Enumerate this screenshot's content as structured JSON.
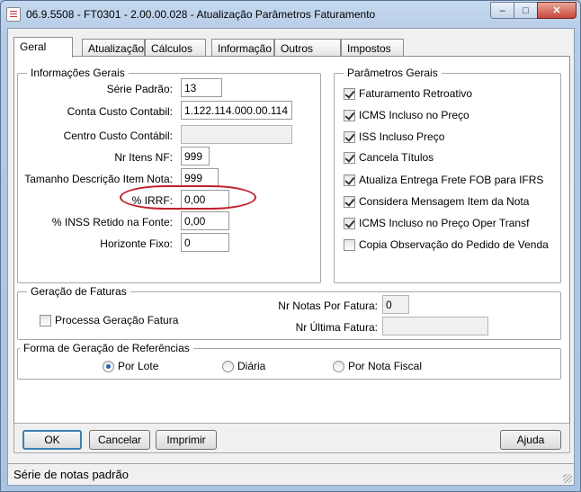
{
  "window": {
    "title": "06.9.5508 - FT0301 - 2.00.00.028 - Atualização Parâmetros Faturamento",
    "minimize_glyph": "–",
    "maximize_glyph": "□",
    "close_glyph": "✕"
  },
  "tabs": [
    {
      "label": "Geral",
      "active": true
    },
    {
      "label": "Atualização"
    },
    {
      "label": "Cálculos"
    },
    {
      "label": "Informação"
    },
    {
      "label": "Outros"
    },
    {
      "label": "Impostos"
    }
  ],
  "informacoes_gerais": {
    "title": "Informações Gerais",
    "fields": [
      {
        "label": "Série Padrão:",
        "value": "13"
      },
      {
        "label": "Conta Custo Contabil:",
        "value": "1.122.114.000.00.114"
      },
      {
        "label": "Centro Custo Contábil:",
        "value": ""
      },
      {
        "label": "Nr Itens NF:",
        "value": "999"
      },
      {
        "label": "Tamanho Descrição Item Nota:",
        "value": "999"
      },
      {
        "label": "% IRRF:",
        "value": "0,00"
      },
      {
        "label": "% INSS Retido na Fonte:",
        "value": "0,00"
      },
      {
        "label": "Horizonte Fixo:",
        "value": "0"
      }
    ]
  },
  "parametros_gerais": {
    "title": "Parâmetros Gerais",
    "checks": [
      {
        "label": "Faturamento Retroativo",
        "checked": true
      },
      {
        "label": "ICMS Incluso no Preço",
        "checked": true
      },
      {
        "label": "ISS Incluso Preço",
        "checked": true
      },
      {
        "label": "Cancela Títulos",
        "checked": true
      },
      {
        "label": "Atualiza Entrega Frete FOB para IFRS",
        "checked": true
      },
      {
        "label": "Considera Mensagem Item da Nota",
        "checked": true
      },
      {
        "label": "ICMS Incluso no Preço Oper Transf",
        "checked": true
      },
      {
        "label": "Copia Observação do Pedido de Venda",
        "checked": false
      }
    ]
  },
  "geracao_faturas": {
    "title": "Geração de Faturas",
    "processa_label": "Processa Geração Fatura",
    "processa_checked": false,
    "nr_notas_label": "Nr Notas Por Fatura:",
    "nr_notas_value": "0",
    "nr_ultima_label": "Nr Última Fatura:",
    "nr_ultima_value": ""
  },
  "forma_geracao": {
    "title": "Forma de Geração de Referências",
    "options": [
      {
        "label": "Por Lote",
        "selected": true
      },
      {
        "label": "Diária",
        "selected": false
      },
      {
        "label": "Por Nota Fiscal",
        "selected": false
      }
    ]
  },
  "buttons": {
    "ok": "OK",
    "cancelar": "Cancelar",
    "imprimir": "Imprimir",
    "ajuda": "Ajuda"
  },
  "status": {
    "text": "Série de notas padrão"
  },
  "colors": {
    "highlight": "#c0202a",
    "radio_dot": "#2a62b8"
  }
}
